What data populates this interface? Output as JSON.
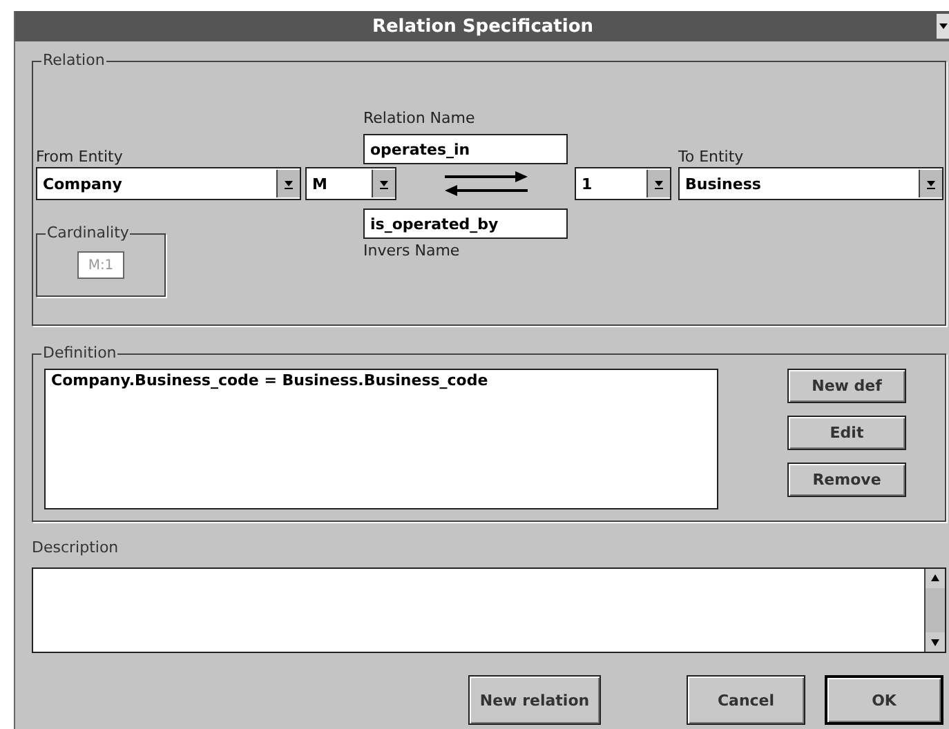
{
  "window": {
    "title": "Relation Specification"
  },
  "relation": {
    "group_label": "Relation",
    "from_entity": {
      "label": "From Entity",
      "value": "Company"
    },
    "from_cardinality": {
      "value": "M"
    },
    "relation_name": {
      "label": "Relation Name",
      "value": "operates_in"
    },
    "inverse_name": {
      "label": "Invers Name",
      "value": "is_operated_by"
    },
    "to_cardinality": {
      "value": "1"
    },
    "to_entity": {
      "label": "To Entity",
      "value": "Business"
    },
    "cardinality": {
      "label": "Cardinality",
      "value": "M:1",
      "disabled": true
    }
  },
  "definition": {
    "label": "Definition",
    "items": [
      "Company.Business_code = Business.Business_code"
    ],
    "buttons": [
      "New def",
      "Edit",
      "Remove"
    ]
  },
  "description": {
    "label": "Description"
  },
  "buttons": [
    {
      "label": "New relation",
      "default": false
    },
    {
      "label": "Cancel",
      "default": false
    },
    {
      "label": "OK",
      "default": true
    }
  ]
}
